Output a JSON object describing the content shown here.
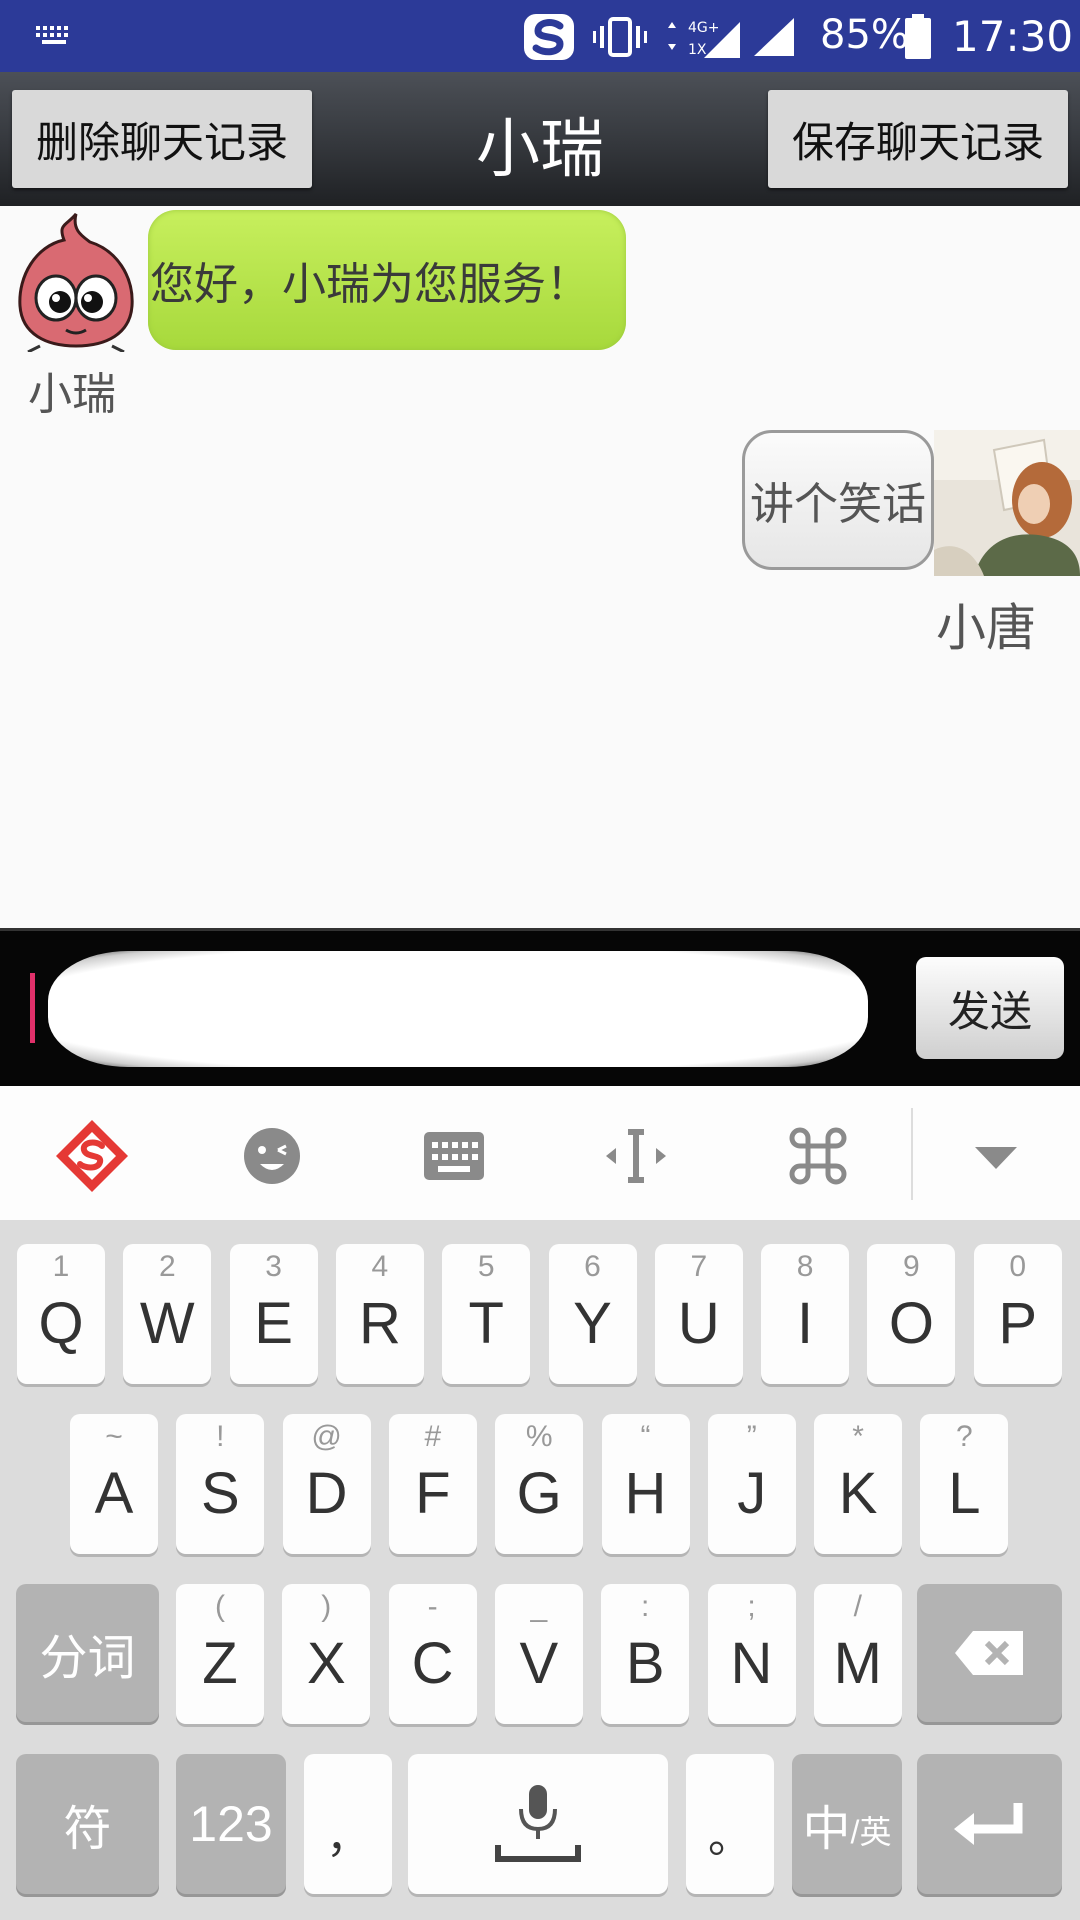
{
  "status_bar": {
    "battery": "85%",
    "time": "17:30",
    "network_top": "4G+",
    "network_bottom": "1X"
  },
  "title_bar": {
    "left_button": "删除聊天记录",
    "title": "小瑞",
    "right_button": "保存聊天记录"
  },
  "chat": {
    "messages": [
      {
        "sender": "小瑞",
        "text": "您好，小瑞为您服务！"
      },
      {
        "sender": "小唐",
        "text": "讲个笑话"
      }
    ]
  },
  "input_bar": {
    "value": "",
    "send_label": "发送"
  },
  "ime_toolbar": {
    "icons": [
      "sogou-logo-icon",
      "emoji-icon",
      "keyboard-icon",
      "cursor-move-icon",
      "command-icon",
      "collapse-icon"
    ]
  },
  "keyboard": {
    "row1": [
      {
        "k": "Q",
        "s": "1"
      },
      {
        "k": "W",
        "s": "2"
      },
      {
        "k": "E",
        "s": "3"
      },
      {
        "k": "R",
        "s": "4"
      },
      {
        "k": "T",
        "s": "5"
      },
      {
        "k": "Y",
        "s": "6"
      },
      {
        "k": "U",
        "s": "7"
      },
      {
        "k": "I",
        "s": "8"
      },
      {
        "k": "O",
        "s": "9"
      },
      {
        "k": "P",
        "s": "0"
      }
    ],
    "row2": [
      {
        "k": "A",
        "s": "~"
      },
      {
        "k": "S",
        "s": "!"
      },
      {
        "k": "D",
        "s": "@"
      },
      {
        "k": "F",
        "s": "#"
      },
      {
        "k": "G",
        "s": "%"
      },
      {
        "k": "H",
        "s": "“"
      },
      {
        "k": "J",
        "s": "”"
      },
      {
        "k": "K",
        "s": "*"
      },
      {
        "k": "L",
        "s": "?"
      }
    ],
    "row3": [
      {
        "k": "Z",
        "s": "("
      },
      {
        "k": "X",
        "s": ")"
      },
      {
        "k": "C",
        "s": "-"
      },
      {
        "k": "V",
        "s": "_"
      },
      {
        "k": "B",
        "s": ":"
      },
      {
        "k": "N",
        "s": ";"
      },
      {
        "k": "M",
        "s": "/"
      }
    ],
    "split_label": "分词",
    "symbol_label": "符",
    "num_label": "123",
    "comma": "，",
    "period": "。",
    "lang_main": "中",
    "lang_sub": "/英"
  }
}
